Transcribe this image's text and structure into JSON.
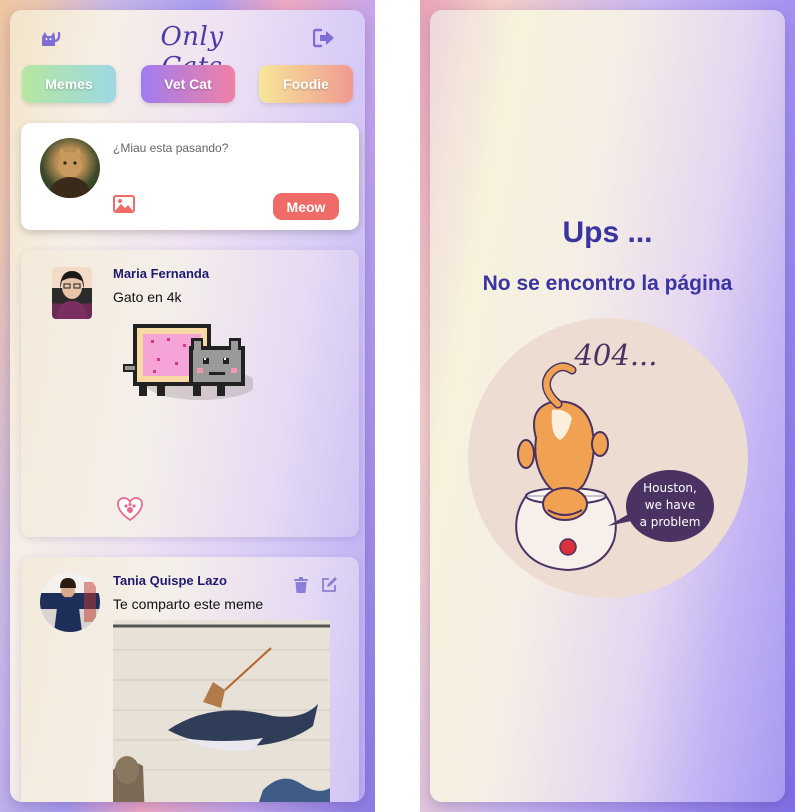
{
  "feed": {
    "logo": "Only Cats",
    "categories": [
      {
        "label": "Memes"
      },
      {
        "label": "Vet Cat"
      },
      {
        "label": "Foodie"
      }
    ],
    "compose": {
      "placeholder": "¿Miau esta pasando?",
      "submit_label": "Meow"
    },
    "posts": [
      {
        "author": "Maria Fernanda",
        "text": "Gato en 4k"
      },
      {
        "author": "Tania Quispe Lazo",
        "text": "Te comparto este meme"
      }
    ]
  },
  "not_found": {
    "title": "Ups ...",
    "message": "No se encontro la página",
    "illustration_code": "404...",
    "speech_bubble": [
      "Houston,",
      "we have",
      "a problem"
    ]
  },
  "colors": {
    "accent_purple": "#7d6ed6",
    "heading_blue": "#3a34a0",
    "meow_red": "#ee6b67"
  }
}
